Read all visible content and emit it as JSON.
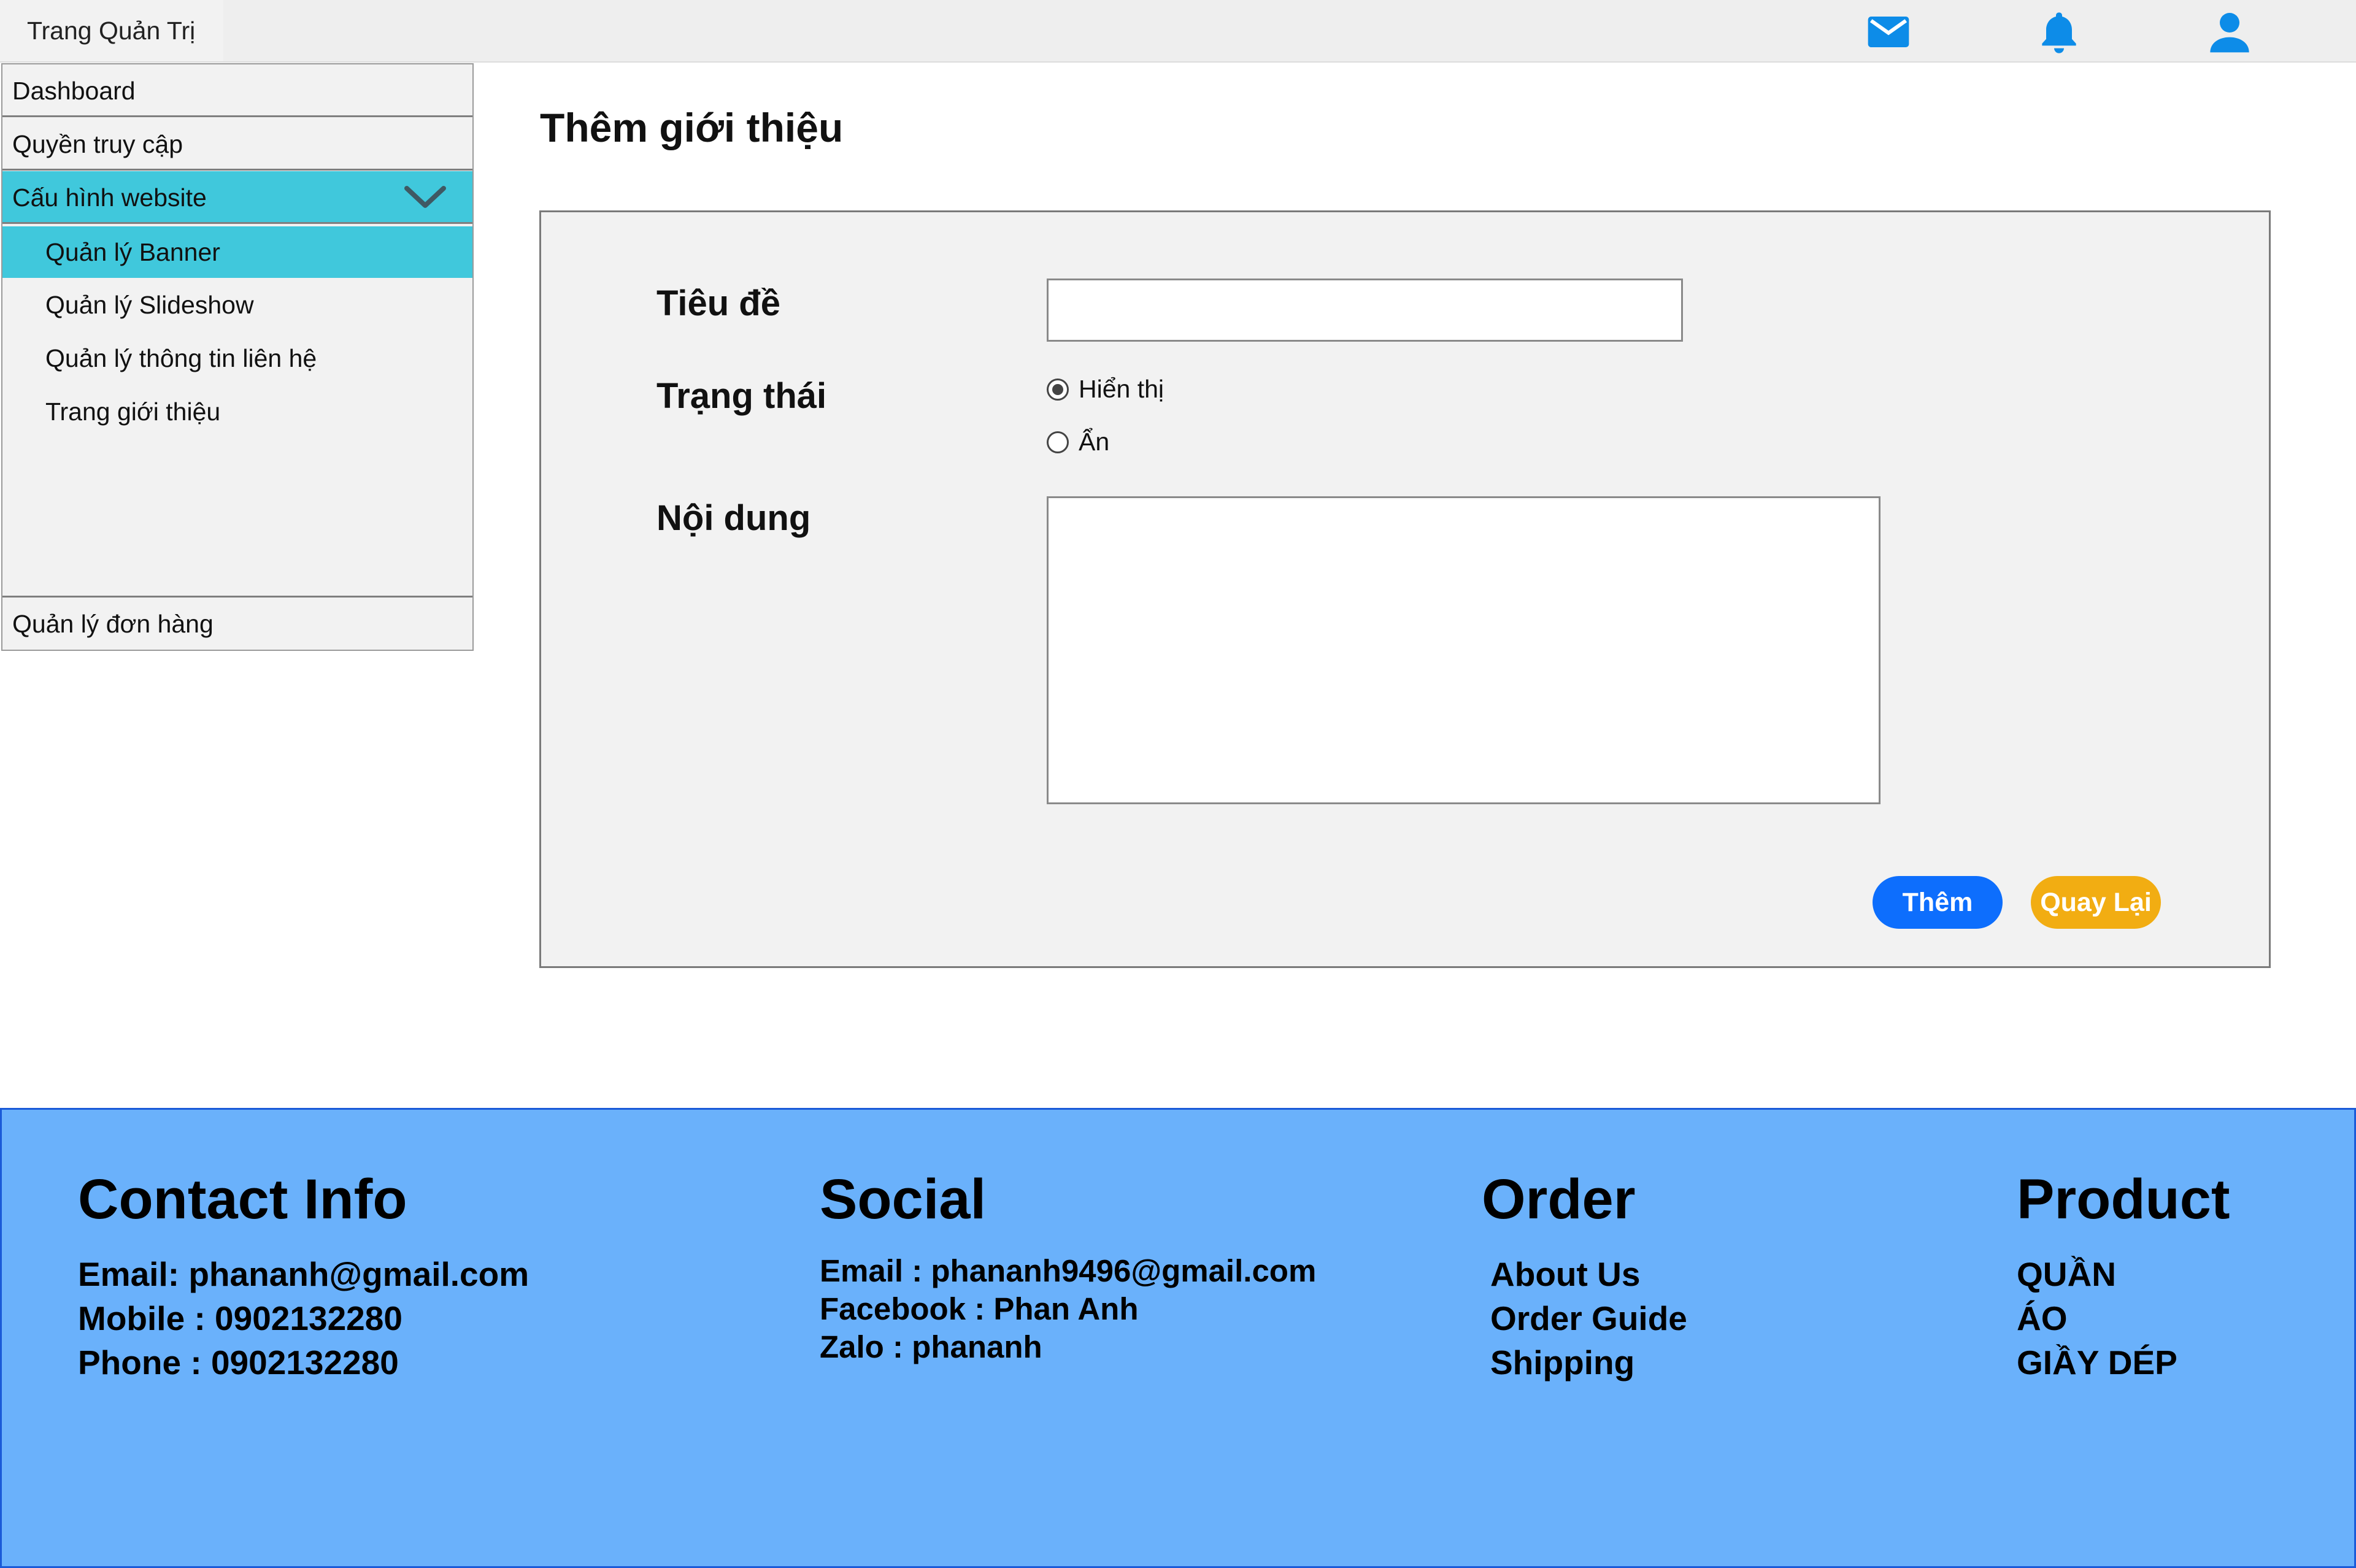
{
  "header": {
    "brand": "Trang Quản Trị",
    "icons": [
      "mail-icon",
      "bell-icon",
      "user-icon"
    ],
    "icon_color": "#0d8ce8"
  },
  "sidebar": {
    "items": [
      {
        "label": "Dashboard"
      },
      {
        "label": "Quyền truy cập"
      },
      {
        "label": "Cấu hình website",
        "expanded": true
      },
      {
        "label": "Quản lý đơn hàng"
      }
    ],
    "subitems": [
      {
        "label": "Quản lý Banner",
        "active": true
      },
      {
        "label": "Quản lý Slideshow"
      },
      {
        "label": "Quản lý thông tin liên hệ"
      },
      {
        "label": "Trang giới thiệu"
      }
    ],
    "active_color": "#40c8dc"
  },
  "main": {
    "title": "Thêm giới thiệu",
    "form": {
      "title_label": "Tiêu đề",
      "title_value": "",
      "status_label": "Trạng thái",
      "status_options": [
        {
          "label": "Hiển thị",
          "selected": true
        },
        {
          "label": "Ẩn",
          "selected": false
        }
      ],
      "content_label": "Nội dung",
      "content_value": ""
    },
    "buttons": {
      "add": "Thêm",
      "back": "Quay Lại"
    }
  },
  "footer": {
    "contact": {
      "heading": "Contact Info",
      "lines": [
        "Email: phananh@gmail.com",
        "Mobile : 0902132280",
        "Phone : 0902132280"
      ]
    },
    "social": {
      "heading": "Social",
      "lines": [
        "Email : phananh9496@gmail.com",
        "Facebook : Phan Anh",
        "Zalo : phananh"
      ]
    },
    "order": {
      "heading": "Order",
      "lines": [
        "About Us",
        "Order Guide",
        "Shipping"
      ]
    },
    "product": {
      "heading": "Product",
      "lines": [
        "QUẦN",
        "ÁO",
        "GIẦY DÉP"
      ]
    },
    "background": "#6ab1fb"
  }
}
